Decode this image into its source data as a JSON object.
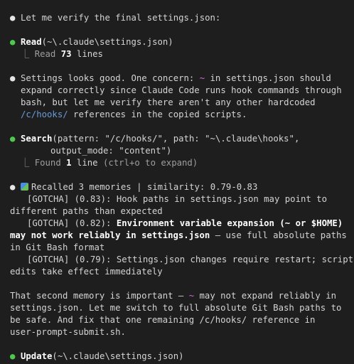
{
  "intro": "Let me verify the final settings.json:",
  "read": {
    "tool": "Read",
    "args": "(~\\.claude\\settings.json)",
    "result_prefix": "⎿ Read ",
    "result_count": "73",
    "result_suffix": " lines"
  },
  "para1": {
    "l1a": "Settings looks good. One concern: ",
    "tilde": "~",
    "l1b": " in settings.json should",
    "l2": "expand correctly since Claude Code runs hook commands through",
    "l3": "bash, but let me verify there aren't any other hardcoded",
    "l4path": "/c/hooks/",
    "l4rest": " references in the copied scripts."
  },
  "search": {
    "tool": "Search",
    "args1": "(pattern: \"/c/hooks/\", path: \"~\\.claude\\hooks\",",
    "args2": "output_mode: \"content\")",
    "result_prefix": "⎿ Found ",
    "result_count": "1",
    "result_mid": " line ",
    "result_hint": "(ctrl+o to expand)"
  },
  "memory": {
    "header": "Recalled 3 memories | similarity: 0.79-0.83",
    "m1a": "[GOTCHA] (0.83): Hook paths in settings.json may point to",
    "m1b": "different paths than expected",
    "m2prefix": "[GOTCHA] (0.82): ",
    "m2bold": "Environment variable expansion (~ or $HOME)",
    "m2b_bold": "may not work reliably in settings.json",
    "m2b_rest": " — use full absolute paths",
    "m2c": "in Git Bash format",
    "m3a": "[GOTCHA] (0.79): Settings.json changes require restart; script",
    "m3b": "edits take effect immediately"
  },
  "para2": {
    "l1a": "That second memory is important — ",
    "tilde": "~",
    "l1b": " may not expand reliably in",
    "l2": "settings.json. Let me switch to full absolute Git Bash paths to",
    "l3": "be safe. And fix that one remaining /c/hooks/ reference in",
    "l4": "user-prompt-submit.sh."
  },
  "update": {
    "tool": "Update",
    "args": "(~\\.claude\\settings.json)"
  }
}
